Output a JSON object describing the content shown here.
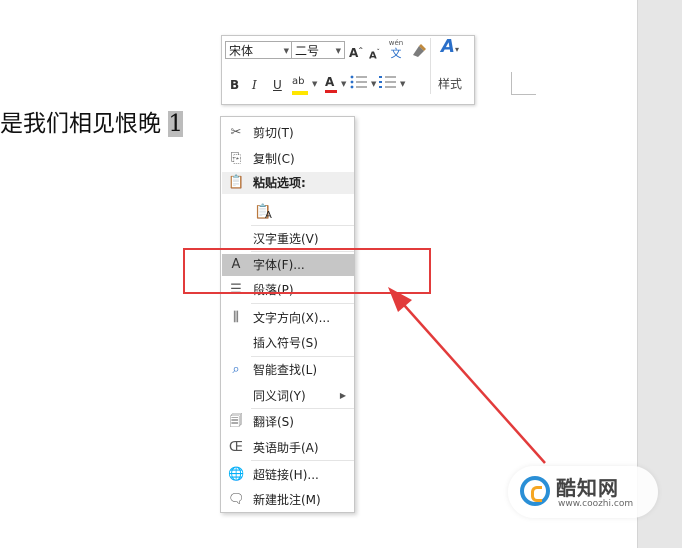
{
  "document": {
    "text": "是我们相见恨晚",
    "selected": "1"
  },
  "mini_toolbar": {
    "font_name": "宋体",
    "font_size": "二号",
    "grow_font": "A",
    "shrink_font": "A",
    "phonetic_top": "wén",
    "phonetic_char": "文",
    "bold": "B",
    "italic": "I",
    "underline": "U",
    "highlight": "ab",
    "font_color": "A",
    "styles_label": "样式"
  },
  "context_menu": {
    "items": [
      {
        "label": "剪切(T)",
        "icon": "scissors-icon"
      },
      {
        "label": "复制(C)",
        "icon": "copy-icon"
      },
      {
        "label": "粘贴选项:",
        "icon": "paste-icon"
      },
      {
        "label": "汉字重选(V)"
      },
      {
        "label": "字体(F)...",
        "icon": "font-icon",
        "glyph": "A"
      },
      {
        "label": "段落(P)...",
        "icon": "paragraph-icon"
      },
      {
        "label": "文字方向(X)...",
        "icon": "text-direction-icon"
      },
      {
        "label": "插入符号(S)"
      },
      {
        "label": "智能查找(L)",
        "icon": "smart-lookup-icon"
      },
      {
        "label": "同义词(Y)"
      },
      {
        "label": "翻译(S)",
        "icon": "translate-icon"
      },
      {
        "label": "英语助手(A)",
        "icon": "english-assistant-icon"
      },
      {
        "label": "超链接(H)...",
        "icon": "hyperlink-icon"
      },
      {
        "label": "新建批注(M)",
        "icon": "new-comment-icon"
      }
    ],
    "paste_glyph": "A"
  },
  "watermark": {
    "name": "酷知网",
    "url": "www.coozhi.com"
  },
  "colors": {
    "highlight": "#c6c6c6",
    "annotation": "#e23b3b",
    "font_color_bar": "#e02020",
    "highlight_bar": "#ffe600"
  }
}
